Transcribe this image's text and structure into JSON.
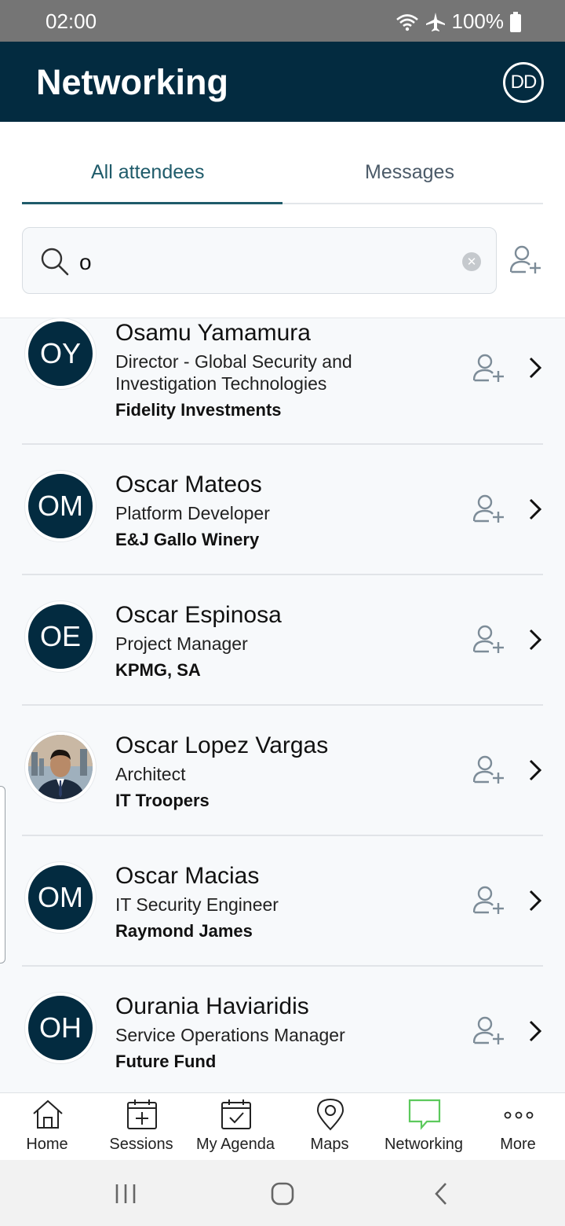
{
  "status_bar": {
    "time": "02:00",
    "battery": "100%"
  },
  "app_bar": {
    "title": "Networking",
    "profile_initials": "DD"
  },
  "tabs": {
    "all_attendees": "All attendees",
    "messages": "Messages",
    "active": "All attendees"
  },
  "search": {
    "value": "o"
  },
  "attendees": [
    {
      "initials": "OY",
      "name": "Osamu Yamamura",
      "role_line1": "Director - Global Security and",
      "role_line2": "Investigation Technologies",
      "company": "Fidelity Investments"
    },
    {
      "initials": "OM",
      "name": "Oscar Mateos",
      "role_line1": "Platform Developer",
      "role_line2": "",
      "company": "E&J Gallo Winery"
    },
    {
      "initials": "OE",
      "name": "Oscar Espinosa",
      "role_line1": "Project Manager",
      "role_line2": "",
      "company": "KPMG, SA"
    },
    {
      "initials": "",
      "name": "Oscar Lopez Vargas",
      "role_line1": "Architect",
      "role_line2": "",
      "company": "IT Troopers",
      "photo": true
    },
    {
      "initials": "OM",
      "name": "Oscar Macias",
      "role_line1": "IT Security Engineer",
      "role_line2": "",
      "company": "Raymond James"
    },
    {
      "initials": "OH",
      "name": "Ourania Haviaridis",
      "role_line1": "Service Operations Manager",
      "role_line2": "",
      "company": "Future Fund"
    }
  ],
  "bottom_nav": {
    "home": "Home",
    "sessions": "Sessions",
    "my_agenda": "My Agenda",
    "maps": "Maps",
    "networking": "Networking",
    "more": "More",
    "active": "Networking"
  },
  "colors": {
    "app_bar": "#032b40",
    "accent_tab": "#1f5b6a",
    "active_nav": "#5cc95c"
  },
  "icons": [
    "wifi-icon",
    "airplane-icon",
    "battery-icon",
    "search-icon",
    "clear-icon",
    "add-contact-icon",
    "chevron-right-icon",
    "home-icon",
    "sessions-icon",
    "agenda-icon",
    "map-pin-icon",
    "chat-icon",
    "more-icon",
    "recent-apps-icon",
    "home-circle-icon",
    "back-icon"
  ]
}
